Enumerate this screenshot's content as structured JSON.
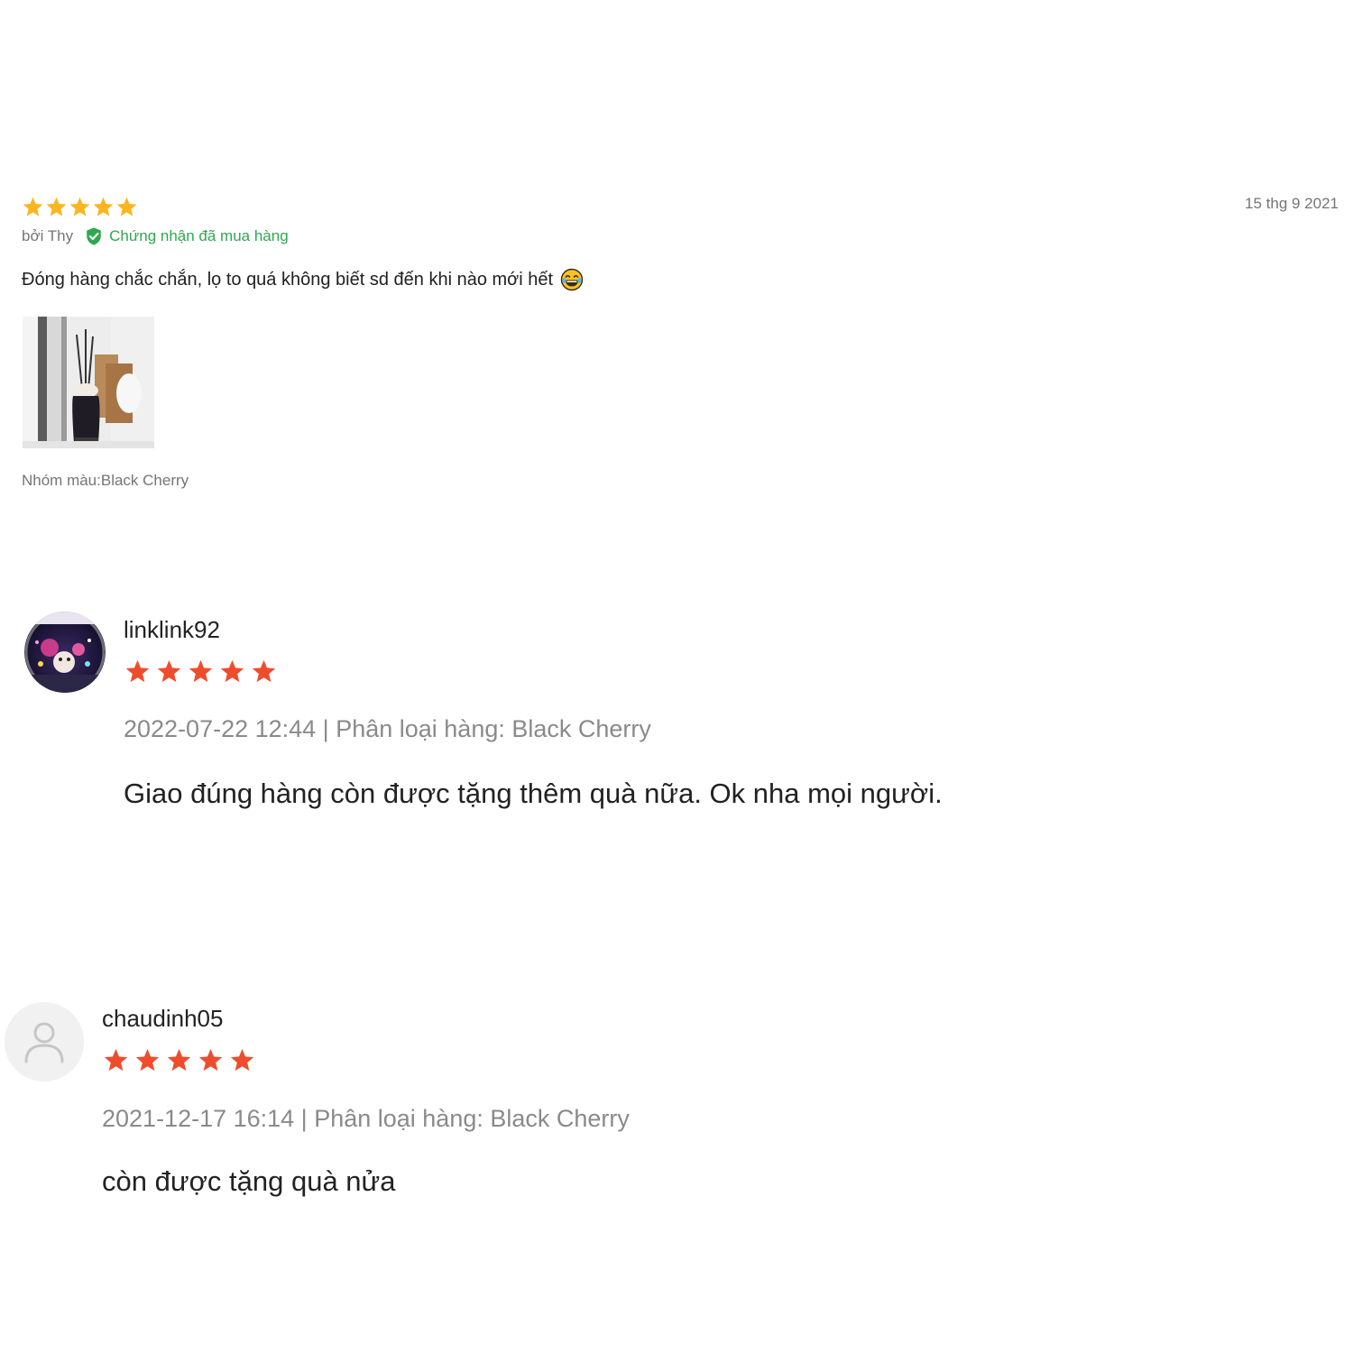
{
  "colors": {
    "lazada_star": "#fbb520",
    "shopee_star": "#ee4d2d",
    "verified_green": "#2fa84f",
    "muted_text": "#757575"
  },
  "review_1": {
    "rating": 5,
    "date": "15 thg 9 2021",
    "by_label": "bởi Thy",
    "verified_icon": "check-shield-icon",
    "verified_label": "Chứng nhận đã mua hàng",
    "content": "Đóng hàng chắc chắn, lọ to quá không biết sd đến khi nào mới hết",
    "emoji": "laughing-tears-emoji",
    "sku": "Nhóm màu:Black Cherry"
  },
  "review_2": {
    "username": "linklink92",
    "rating": 5,
    "meta": "2022-07-22 12:44 | Phân loại hàng: Black Cherry",
    "comment": "Giao đúng hàng còn được tặng thêm quà nữa. Ok nha mọi người."
  },
  "review_3": {
    "username": "chaudinh05",
    "rating": 5,
    "avatar_icon": "default-user-icon",
    "meta": "2021-12-17 16:14 | Phân loại hàng: Black Cherry",
    "comment": "còn được tặng quà nửa"
  }
}
